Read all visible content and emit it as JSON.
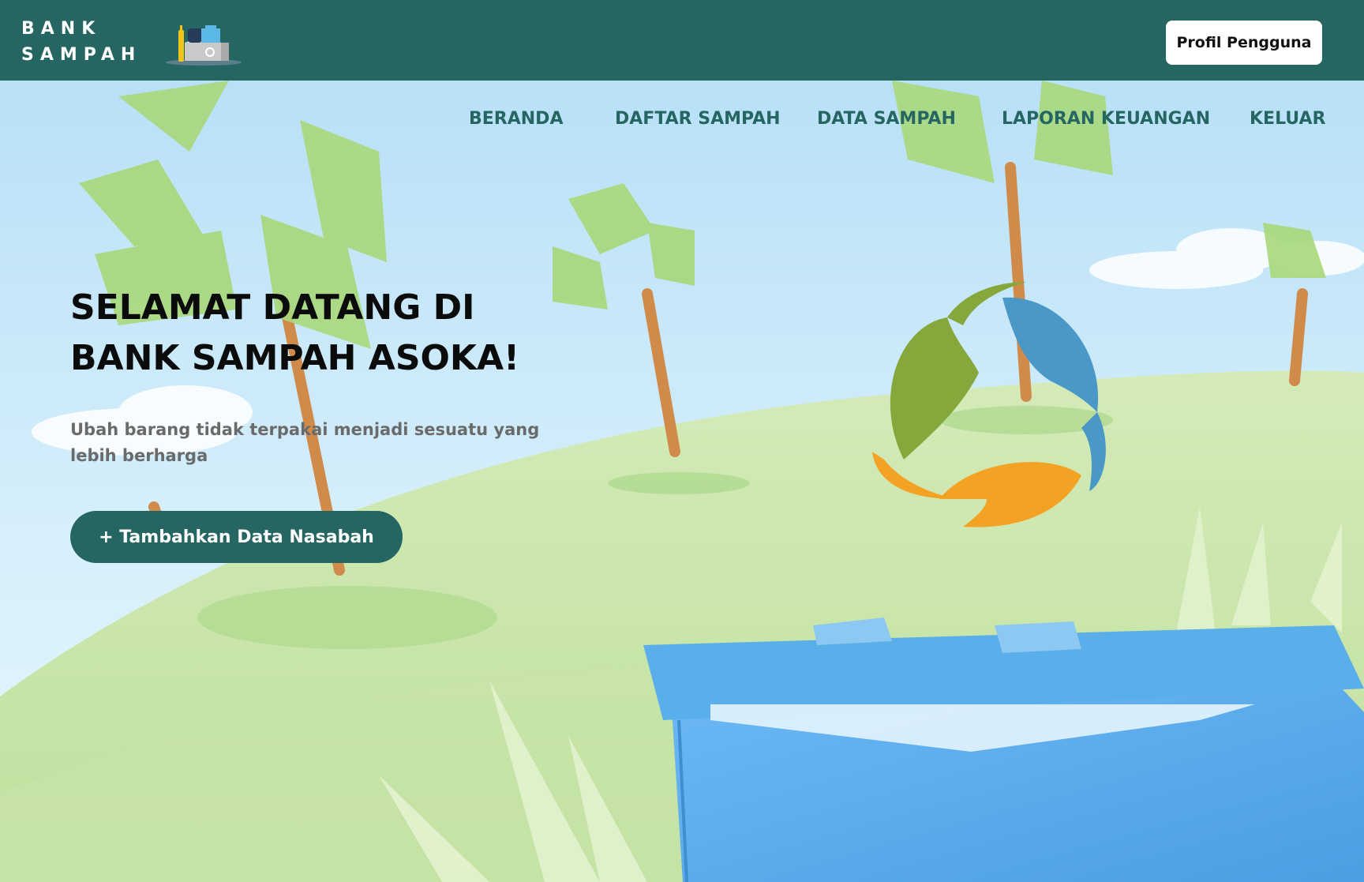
{
  "header": {
    "brand_line1": "BANK",
    "brand_line2": "SAMPAH",
    "profile_button": "Profil Pengguna",
    "background_color": "#266662"
  },
  "nav": {
    "items": [
      {
        "label": "BERANDA"
      },
      {
        "label": "DAFTAR SAMPAH"
      },
      {
        "label": "DATA SAMPAH"
      },
      {
        "label": "LAPORAN KEUANGAN"
      },
      {
        "label": "KELUAR"
      }
    ]
  },
  "hero": {
    "title_line1": "SELAMAT DATANG DI",
    "title_line2": "BANK SAMPAH ASOKA!",
    "subtitle": "Ubah barang tidak terpakai menjadi sesuatu yang lebih berharga",
    "cta_label": "+ Tambahkan Data Nasabah"
  },
  "icons": {
    "brand_logo": "recycle-bins-icon",
    "emblem": "recycle-leaves-icon"
  },
  "colors": {
    "primary": "#266662",
    "leaf_green": "#86a73c",
    "leaf_blue": "#4a98c8",
    "leaf_orange": "#f4a224"
  }
}
